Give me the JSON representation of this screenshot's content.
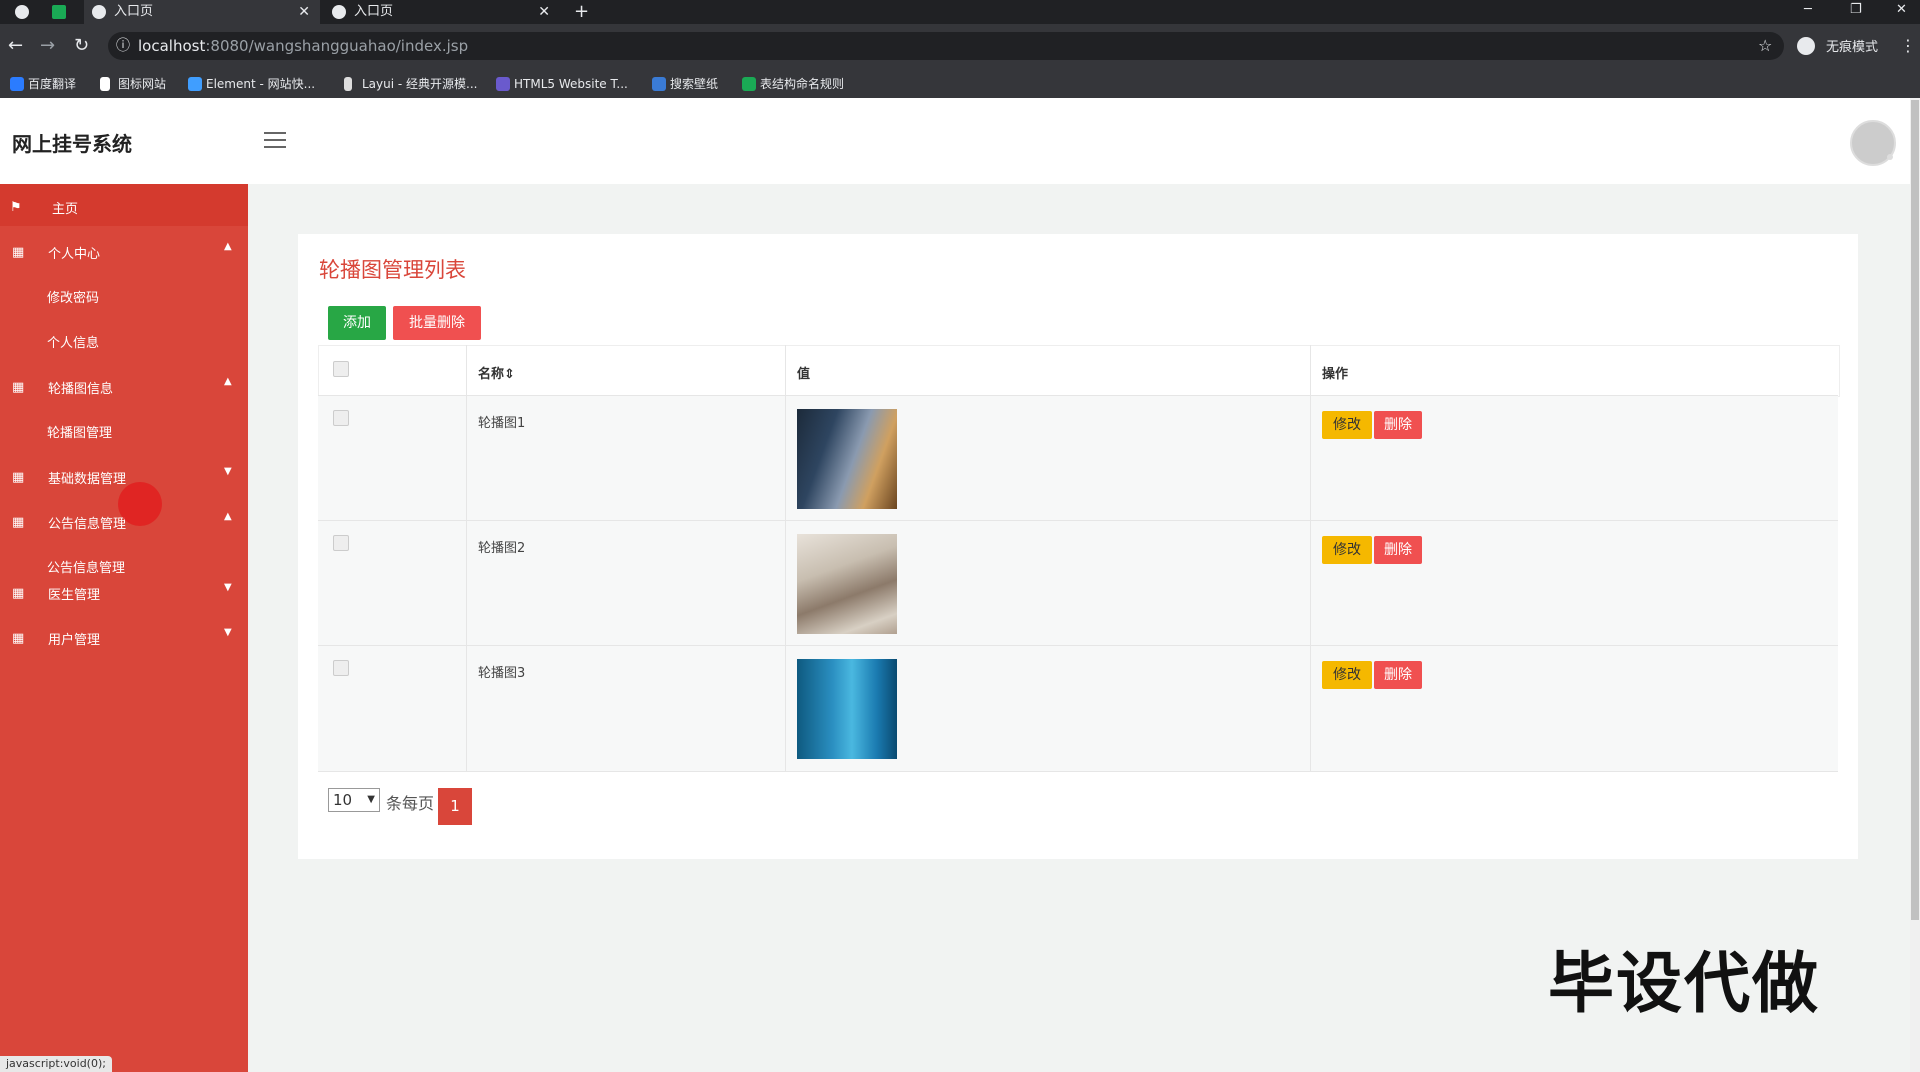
{
  "browser": {
    "tabs": [
      {
        "label": ""
      },
      {
        "label": "入口页"
      },
      {
        "label": "入口页"
      }
    ],
    "url_host": "localhost",
    "url_path": ":8080/wangshangguahao/index.jsp",
    "incognito_label": "无痕模式",
    "bookmarks": [
      {
        "label": "百度翻译",
        "color": "#2b7cff"
      },
      {
        "label": "图标网站",
        "color": "#ffffff"
      },
      {
        "label": "Element - 网站快...",
        "color": "#409eff"
      },
      {
        "label": "Layui - 经典开源模...",
        "color": "#dddddd"
      },
      {
        "label": "HTML5 Website T...",
        "color": "#6a5acd"
      },
      {
        "label": "搜索壁纸",
        "color": "#3a7bd5"
      },
      {
        "label": "表结构命名规则",
        "color": "#1aaa55"
      }
    ],
    "status_text": "javascript:void(0);"
  },
  "app": {
    "title": "网上挂号系统"
  },
  "sidebar": {
    "items": [
      {
        "label": "主页",
        "icon": "flag-icon",
        "type": "item"
      },
      {
        "label": "个人中心",
        "icon": "grid-icon",
        "type": "group",
        "caret": "▲"
      },
      {
        "label": "修改密码",
        "type": "sub"
      },
      {
        "label": "个人信息",
        "type": "sub"
      },
      {
        "label": "轮播图信息",
        "icon": "grid-icon",
        "type": "group",
        "caret": "▲"
      },
      {
        "label": "轮播图管理",
        "type": "sub"
      },
      {
        "label": "基础数据管理",
        "icon": "grid-icon",
        "type": "group",
        "caret": "▼"
      },
      {
        "label": "公告信息管理",
        "icon": "grid-icon",
        "type": "group",
        "caret": "▲"
      },
      {
        "label": "公告信息管理",
        "type": "sub"
      },
      {
        "label": "医生管理",
        "icon": "grid-icon",
        "type": "group",
        "caret": "▼"
      },
      {
        "label": "用户管理",
        "icon": "grid-icon",
        "type": "group",
        "caret": "▼"
      }
    ]
  },
  "main": {
    "title": "轮播图管理列表",
    "add_label": "添加",
    "batch_delete_label": "批量删除",
    "columns": [
      "名称⇕",
      "值",
      "操作"
    ],
    "rows": [
      {
        "name": "轮播图1"
      },
      {
        "name": "轮播图2"
      },
      {
        "name": "轮播图3"
      }
    ],
    "edit_label": "修改",
    "delete_label": "删除",
    "page_size": "10",
    "per_page_label": "条每页",
    "current_page": "1"
  },
  "watermark": "毕设代做",
  "colors": {
    "sidebar": "#d9463a",
    "accent": "#d9463a",
    "add": "#28a745",
    "danger": "#f05050",
    "warning": "#f5b800"
  }
}
